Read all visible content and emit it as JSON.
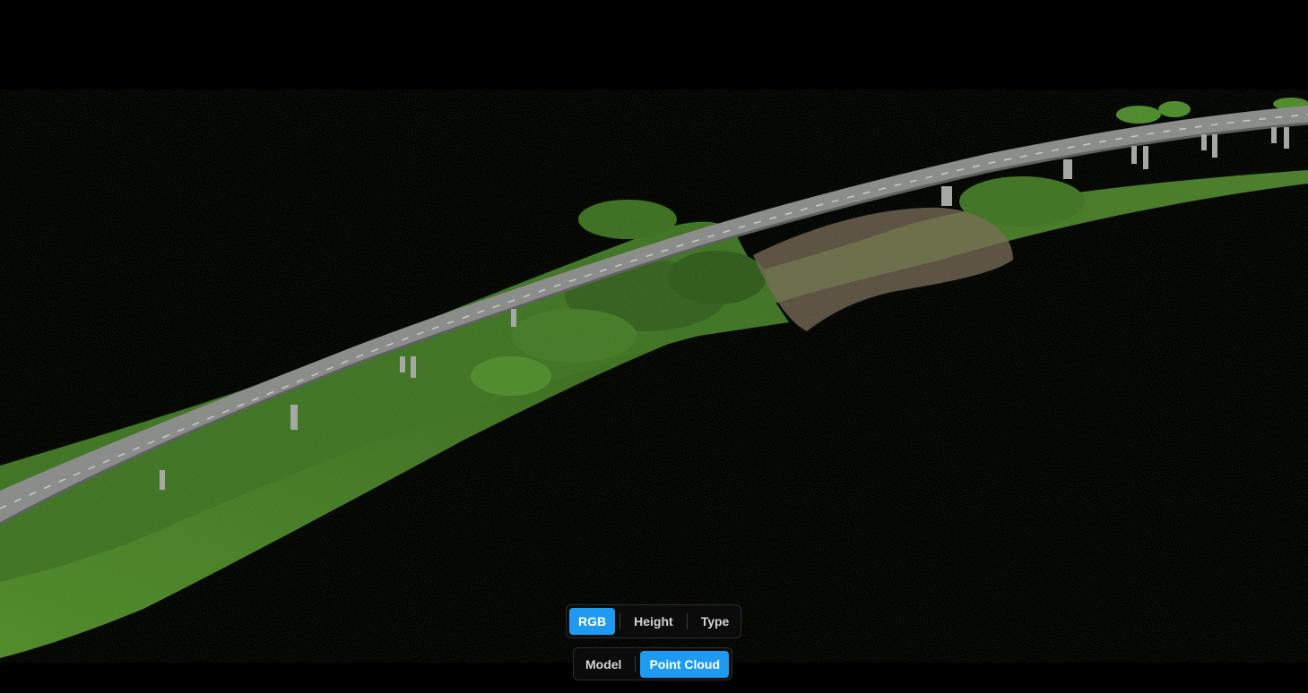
{
  "viewer": {
    "background_color": "#000000",
    "scene_icon": "point-cloud-bridge-scene",
    "vegetation_colors": [
      "#2f5a1c",
      "#4a7f29",
      "#6a9a35",
      "#3f6b24"
    ],
    "road_color": "#8a8d8a",
    "bare_ground_color": "#7a6a58"
  },
  "color_mode": {
    "options": [
      {
        "id": "rgb",
        "label": "RGB",
        "active": true
      },
      {
        "id": "height",
        "label": "Height",
        "active": false
      },
      {
        "id": "type",
        "label": "Type",
        "active": false
      }
    ],
    "active_color": "#1e9bf0"
  },
  "view_mode": {
    "options": [
      {
        "id": "model",
        "label": "Model",
        "active": false
      },
      {
        "id": "point-cloud",
        "label": "Point Cloud",
        "active": true
      }
    ],
    "active_color": "#1e9bf0"
  }
}
